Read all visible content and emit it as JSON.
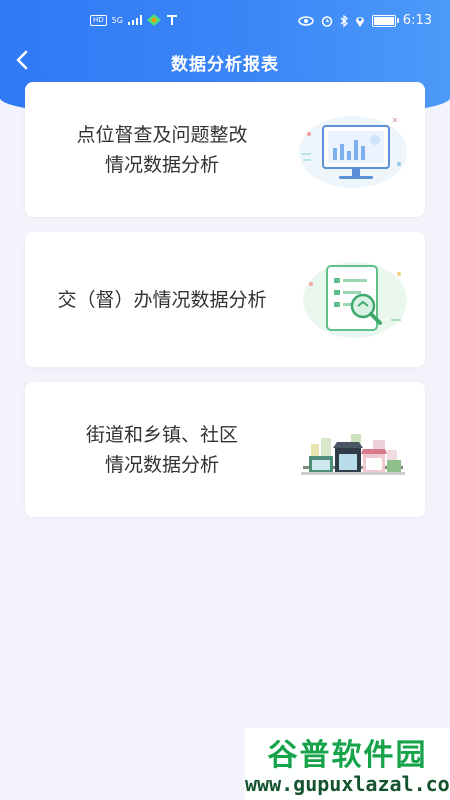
{
  "status_bar": {
    "left_badge": "HD",
    "network_label": "5G",
    "time": "6:13",
    "battery_level": 0.9
  },
  "header": {
    "title": "数据分析报表",
    "back_icon": "chevron-left-icon"
  },
  "cards": [
    {
      "line1": "点位督查及问题整改",
      "line2": "情况数据分析",
      "icon": "monitor-chart-illustration"
    },
    {
      "line1": "交（督）办情况数据分析",
      "line2": "",
      "icon": "document-search-illustration"
    },
    {
      "line1": "街道和乡镇、社区",
      "line2": "情况数据分析",
      "icon": "town-buildings-illustration"
    }
  ],
  "watermark": {
    "title": "谷普软件园",
    "url": "www.gupuxlazal.com"
  },
  "colors": {
    "header_blue": "#2f79f5",
    "background": "#f3f4fb",
    "card": "#ffffff"
  }
}
